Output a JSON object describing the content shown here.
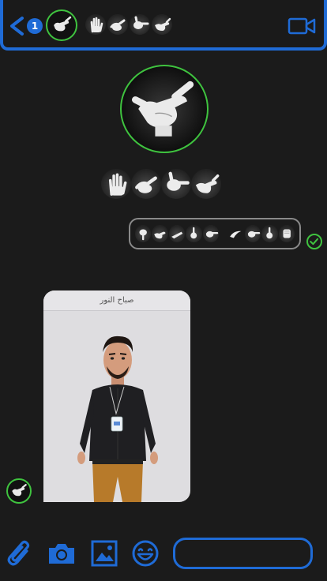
{
  "header": {
    "unread_count": "1",
    "contact_name_signs": [
      "open-palm-sign",
      "pointing-sign",
      "thumb-point-sign",
      "shaka-sign"
    ]
  },
  "profile": {
    "name_signs": [
      "open-palm-sign",
      "pointing-sign",
      "thumb-point-sign",
      "shaka-sign"
    ]
  },
  "outgoing_message": {
    "signs": [
      "point-down-sign",
      "shaka-sign",
      "flat-hand-sign",
      "index-up-sign",
      "thumb-point-sign",
      "curve-hand-sign",
      "thumb-point-sign",
      "index-up-sign",
      "fist-sign"
    ],
    "status": "delivered"
  },
  "incoming_video": {
    "title": "صباح النور"
  },
  "toolbar": {
    "icons": [
      "paperclip-icon",
      "camera-icon",
      "image-icon",
      "emoji-icon"
    ]
  },
  "colors": {
    "accent": "#1f6bd6",
    "online": "#3fc33f",
    "background": "#1b1b1b"
  }
}
